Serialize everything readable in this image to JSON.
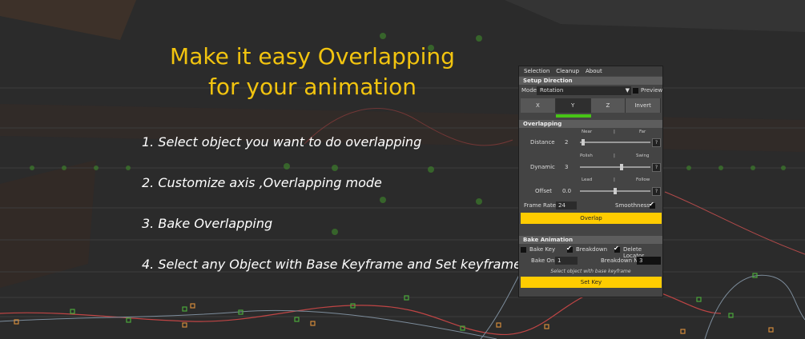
{
  "headline": {
    "line1": "Make it easy Overlapping",
    "line2": "for your animation"
  },
  "steps": [
    "1. Select object you want to do overlapping",
    "2. Customize axis ,Overlapping mode",
    "3. Bake Overlapping",
    "4. Select any Object with Base Keyframe and Set keyframe"
  ],
  "panel": {
    "menu": [
      "Selection",
      "Cleanup",
      "About"
    ],
    "setup_direction": "Setup Direction",
    "mode_label": "Mode",
    "mode_value": "Rotation",
    "preview_label": "Preview",
    "axes": [
      "X",
      "Y",
      "Z",
      "Invert"
    ],
    "active_axis": "Y",
    "overlapping_title": "Overlapping",
    "distance": {
      "label": "Distance",
      "value": "2",
      "left": "Near",
      "mid": "|",
      "right": "Far",
      "level": 0.02
    },
    "dynamic": {
      "label": "Dynamic",
      "value": "3",
      "left": "Polish",
      "mid": "|",
      "right": "Swing",
      "level": 0.6
    },
    "offset": {
      "label": "Offset",
      "value": "0.0",
      "left": "Lead",
      "mid": "|",
      "right": "Follow",
      "level": 0.5
    },
    "help_icon": "?",
    "frame_rate_label": "Frame Rate",
    "frame_rate_value": "24",
    "smoothness_label": "Smoothness",
    "smoothness_checked": true,
    "overlap_button": "Overlap",
    "bake_title": "Bake Animation",
    "bake_key_label": "Bake Key",
    "bake_key_checked": false,
    "breakdown_label": "Breakdown",
    "breakdown_checked": true,
    "delete_locator_label": "Delete Locator",
    "delete_locator_checked": true,
    "bake_on_label": "Bake On",
    "bake_on_value": "1",
    "breakdown_n_label": "Breakdown N",
    "breakdown_n_value": "3",
    "hint": "Select object with base keyframe",
    "set_key_button": "Set Key"
  },
  "colors": {
    "accent": "#f2c40f",
    "button": "#ffcc00",
    "green_bar": "#47c416",
    "background": "#2b2b2b"
  }
}
